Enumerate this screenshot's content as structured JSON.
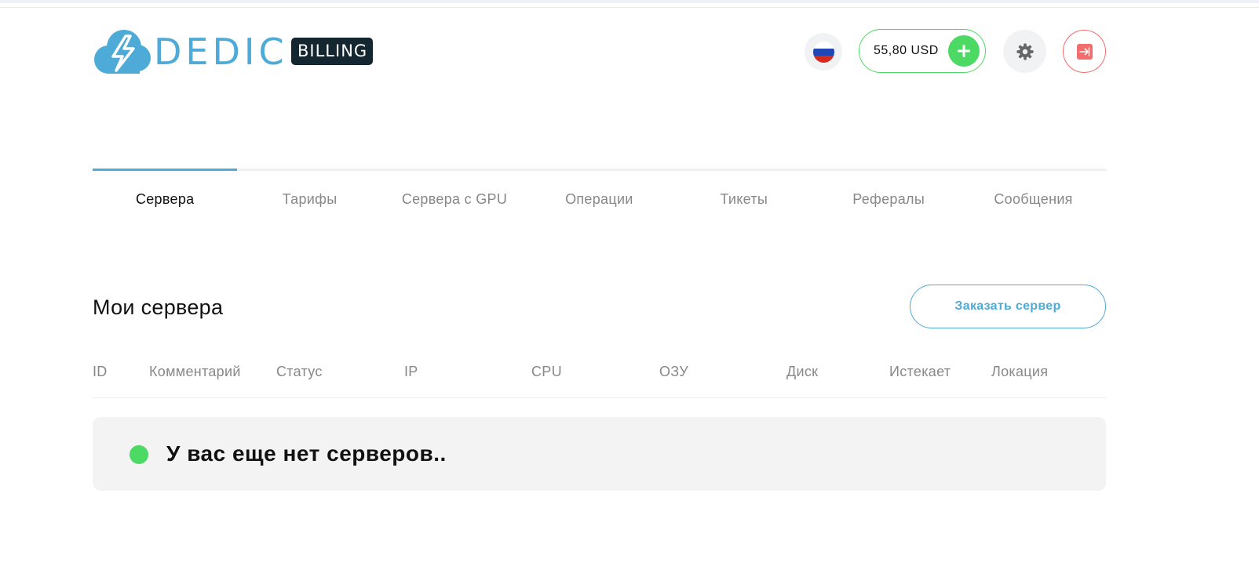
{
  "header": {
    "logo_text": "DEDIC",
    "badge": "BILLING",
    "balance": "55,80 USD",
    "icons": {
      "logo": "lightning-cloud-icon",
      "language": "russia-flag-icon",
      "topup": "plus-icon",
      "settings": "gear-icon",
      "logout": "logout-icon"
    }
  },
  "tabs": [
    {
      "label": "Сервера",
      "active": true
    },
    {
      "label": "Тарифы",
      "active": false
    },
    {
      "label": "Сервера с GPU",
      "active": false
    },
    {
      "label": "Операции",
      "active": false
    },
    {
      "label": "Тикеты",
      "active": false
    },
    {
      "label": "Рефералы",
      "active": false
    },
    {
      "label": "Сообщения",
      "active": false
    }
  ],
  "servers": {
    "title": "Мои сервера",
    "order_button": "Заказать сервер",
    "columns": [
      "ID",
      "Комментарий",
      "Статус",
      "IP",
      "CPU",
      "ОЗУ",
      "Диск",
      "Истекает",
      "Локация"
    ],
    "empty_message": "У вас еще нет серверов.."
  },
  "colors": {
    "accent": "#4eaad6",
    "success": "#4cd964",
    "danger": "#f26d6d",
    "badge_bg": "#142630"
  }
}
